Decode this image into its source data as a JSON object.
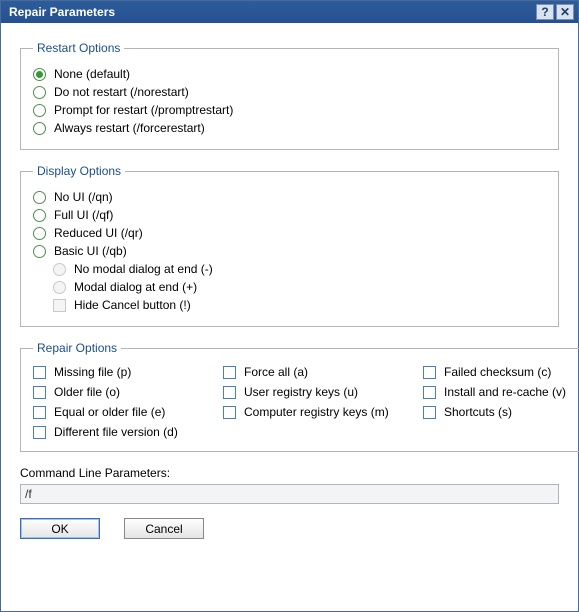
{
  "window": {
    "title": "Repair Parameters"
  },
  "restart": {
    "legend": "Restart Options",
    "options": {
      "none": "None (default)",
      "norestart": "Do not restart (/norestart)",
      "promptrestart": "Prompt for restart (/promptrestart)",
      "forcerestart": "Always restart (/forcerestart)"
    },
    "selected": "none"
  },
  "display": {
    "legend": "Display Options",
    "options": {
      "qn": "No UI (/qn)",
      "qf": "Full UI (/qf)",
      "qr": "Reduced UI (/qr)",
      "qb": "Basic UI (/qb)"
    },
    "sub": {
      "no_modal": "No modal dialog at end (-)",
      "modal": "Modal dialog at end (+)",
      "hide_cancel": "Hide Cancel button (!)"
    },
    "selected": null
  },
  "repair": {
    "legend": "Repair Options",
    "options": {
      "p": "Missing file (p)",
      "o": "Older file (o)",
      "e": "Equal or older file (e)",
      "d": "Different file version (d)",
      "a": "Force all (a)",
      "u": "User registry keys (u)",
      "m": "Computer registry keys (m)",
      "c": "Failed checksum (c)",
      "v": "Install and re-cache (v)",
      "s": "Shortcuts (s)"
    }
  },
  "command": {
    "label": "Command Line Parameters:",
    "value": "/f"
  },
  "buttons": {
    "ok": "OK",
    "cancel": "Cancel"
  }
}
